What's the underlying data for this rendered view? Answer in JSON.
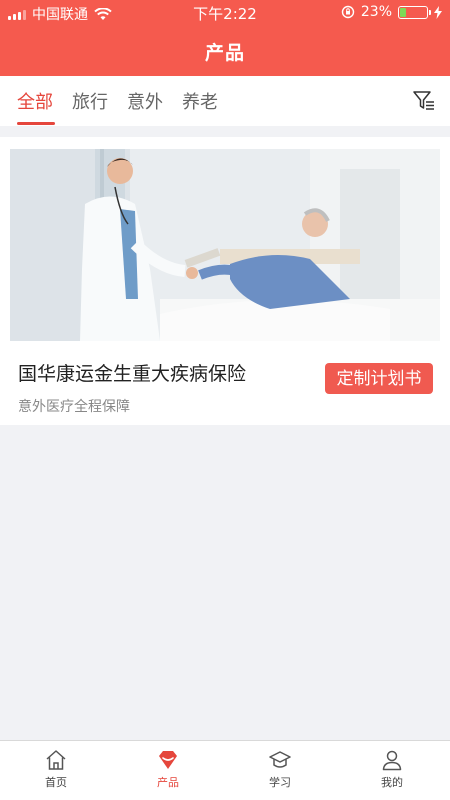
{
  "status_bar": {
    "carrier": "中国联通",
    "time": "下午2:22",
    "battery": "23%",
    "battery_level": 0.23
  },
  "header": {
    "title": "产品"
  },
  "tabs": [
    {
      "label": "全部",
      "active": true
    },
    {
      "label": "旅行",
      "active": false
    },
    {
      "label": "意外",
      "active": false
    },
    {
      "label": "养老",
      "active": false
    }
  ],
  "products": [
    {
      "name": "国华康运金生重大疾病保险",
      "subtitle": "意外医疗全程保障",
      "button_label": "定制计划书"
    }
  ],
  "bottom_nav": [
    {
      "label": "首页",
      "icon": "home-icon",
      "active": false
    },
    {
      "label": "产品",
      "icon": "product-gem-icon",
      "active": true
    },
    {
      "label": "学习",
      "icon": "graduation-cap-icon",
      "active": false
    },
    {
      "label": "我的",
      "icon": "user-icon",
      "active": false
    }
  ],
  "colors": {
    "brand": "#f55a4e",
    "accent": "#e5463c",
    "battery_fill": "#7ed957"
  }
}
